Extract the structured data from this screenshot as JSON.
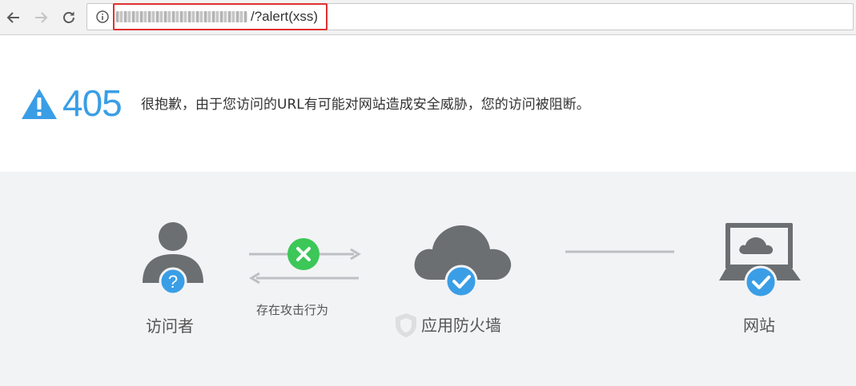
{
  "browser": {
    "back_icon": "arrow-left-icon",
    "forward_icon": "arrow-right-icon",
    "reload_icon": "reload-icon",
    "info_icon": "info-icon",
    "url_path": "/?alert(xss)"
  },
  "error": {
    "code": "405",
    "message": "很抱歉，由于您访问的URL有可能对网站造成安全威胁，您的访问被阻断。"
  },
  "diagram": {
    "visitor_label": "访问者",
    "attack_label": "存在攻击行为",
    "firewall_label": "应用防火墙",
    "website_label": "网站"
  },
  "colors": {
    "accent_blue": "#3a9ee6",
    "block_green": "#3cc758",
    "highlight_red": "#e03030",
    "icon_gray": "#6b6f72"
  }
}
